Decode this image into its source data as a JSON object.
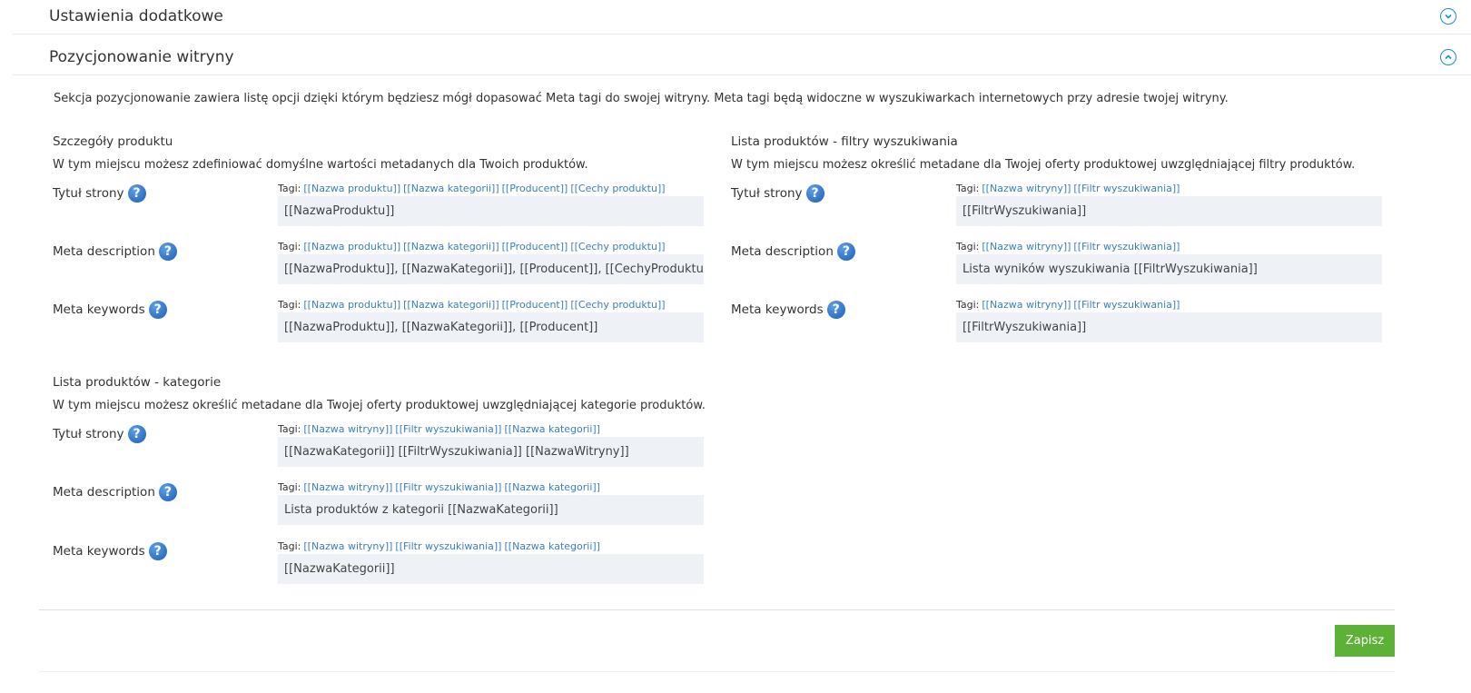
{
  "accordion": {
    "section1_title": "Ustawienia dodatkowe",
    "section2_title": "Pozycjonowanie witryny"
  },
  "intro": "Sekcja pozycjonowanie zawiera listę opcji dzięki którym będziesz mógł dopasować Meta tagi do swojej witryny. Meta tagi będą widoczne w wyszukiwarkach internetowych przy adresie twojej witryny.",
  "tags_prefix": "Tagi:",
  "product_details": {
    "title": "Szczegóły produktu",
    "description": "W tym miejscu możesz zdefiniować domyślne wartości metadanych dla Twoich produktów.",
    "tags": [
      "[[Nazwa produktu]]",
      "[[Nazwa kategorii]]",
      "[[Producent]]",
      "[[Cechy produktu]]"
    ],
    "rows": [
      {
        "label": "Tytuł strony",
        "value": "[[NazwaProduktu]]"
      },
      {
        "label": "Meta description",
        "value": "[[NazwaProduktu]], [[NazwaKategorii]], [[Producent]], [[CechyProduktu]]"
      },
      {
        "label": "Meta keywords",
        "value": "[[NazwaProduktu]], [[NazwaKategorii]], [[Producent]]"
      }
    ]
  },
  "search_filters": {
    "title": "Lista produktów - filtry wyszukiwania",
    "description": "W tym miejscu możesz określić metadane dla Twojej oferty produktowej uwzględniającej filtry produktów.",
    "tags": [
      "[[Nazwa witryny]]",
      "[[Filtr wyszukiwania]]"
    ],
    "rows": [
      {
        "label": "Tytuł strony",
        "value": "[[FiltrWyszukiwania]]"
      },
      {
        "label": "Meta description",
        "value": "Lista wyników wyszukiwania [[FiltrWyszukiwania]]"
      },
      {
        "label": "Meta keywords",
        "value": "[[FiltrWyszukiwania]]"
      }
    ]
  },
  "categories": {
    "title": "Lista produktów - kategorie",
    "description": "W tym miejscu możesz określić metadane dla Twojej oferty produktowej uwzględniającej kategorie produktów.",
    "tags": [
      "[[Nazwa witryny]]",
      "[[Filtr wyszukiwania]]",
      "[[Nazwa kategorii]]"
    ],
    "rows": [
      {
        "label": "Tytuł strony",
        "value": "[[NazwaKategorii]] [[FiltrWyszukiwania]] [[NazwaWitryny]]"
      },
      {
        "label": "Meta description",
        "value": "Lista produktów z kategorii [[NazwaKategorii]]"
      },
      {
        "label": "Meta keywords",
        "value": "[[NazwaKategorii]]"
      }
    ]
  },
  "help_glyph": "?",
  "save_label": "Zapisz",
  "colors": {
    "accent": "#1a8fc9",
    "tag_link": "#3a7fc4",
    "field_bg": "#eef2f6",
    "save_button": "#5cb136"
  }
}
